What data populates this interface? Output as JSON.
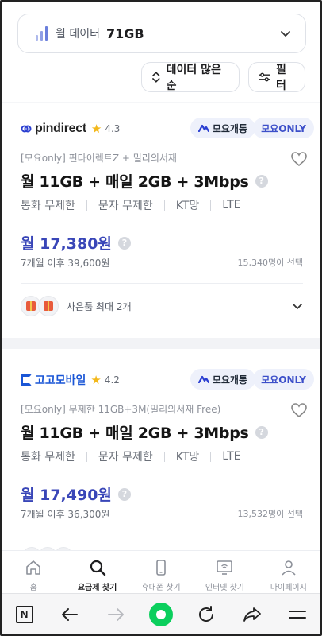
{
  "data_filter": {
    "label": "월 데이터",
    "value": "71GB",
    "icon": "signal-bars-icon"
  },
  "sort_button": {
    "label": "데이터 많은순",
    "icon": "sort-updown-icon"
  },
  "filter_button": {
    "label": "필터",
    "icon": "sliders-icon"
  },
  "plans": [
    {
      "brand": "pindirect",
      "rating": "4.3",
      "badges": [
        "모요개통",
        "모요ONLY"
      ],
      "subtitle": "[모요only] 핀다이렉트Z + 밀리의서재",
      "title": "월 11GB + 매일 2GB + 3Mbps",
      "features": [
        "통화 무제한",
        "문자 무제한",
        "KT망",
        "LTE"
      ],
      "price": "월 17,380원",
      "price_after": "7개월 이후 39,600원",
      "selected_count": "15,340명이 선택",
      "gift_text": "사은품 최대 2개"
    },
    {
      "brand": "고고모바일",
      "rating": "4.2",
      "badges": [
        "모요개통",
        "모요ONLY"
      ],
      "subtitle": "[모요only] 무제한 11GB+3M(밀리의서재 Free)",
      "title": "월 11GB + 매일 2GB + 3Mbps",
      "features": [
        "통화 무제한",
        "문자 무제한",
        "KT망",
        "LTE"
      ],
      "price": "월 17,490원",
      "price_after": "7개월 이후 36,300원",
      "selected_count": "13,532명이 선택"
    }
  ],
  "help_glyph": "?",
  "app_nav": [
    {
      "label": "홈",
      "icon": "home-icon"
    },
    {
      "label": "요금제 찾기",
      "icon": "search-icon",
      "active": true
    },
    {
      "label": "휴대폰 찾기",
      "icon": "phone-icon"
    },
    {
      "label": "인터넷 찾기",
      "icon": "monitor-wifi-icon"
    },
    {
      "label": "마이페이지",
      "icon": "user-icon"
    }
  ],
  "browser_toolbar": {
    "logo_letter": "N",
    "buttons": [
      "back-arrow-icon",
      "forward-arrow-icon",
      "home-dot-icon",
      "reload-icon",
      "share-icon",
      "menu-icon"
    ]
  },
  "colors": {
    "accent": "#3946b8",
    "badge_only": "#3c4fc9",
    "star": "#f3b81b",
    "browser_green": "#0bcf5d"
  }
}
